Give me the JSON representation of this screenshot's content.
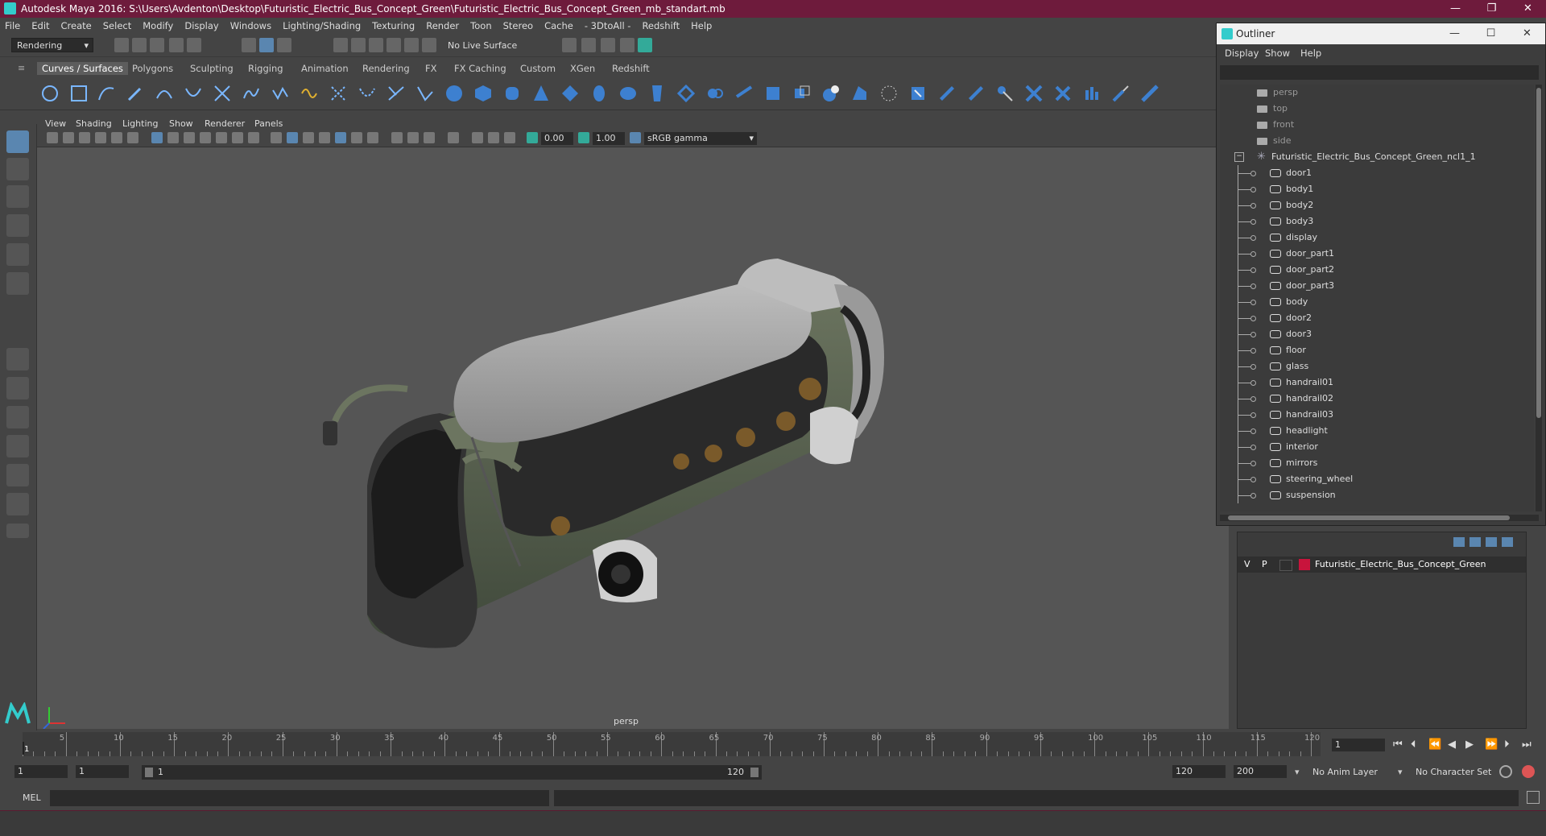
{
  "window": {
    "title": "Autodesk Maya 2016: S:\\Users\\Avdenton\\Desktop\\Futuristic_Electric_Bus_Concept_Green\\Futuristic_Electric_Bus_Concept_Green_mb_standart.mb"
  },
  "menubar": [
    "File",
    "Edit",
    "Create",
    "Select",
    "Modify",
    "Display",
    "Windows",
    "Lighting/Shading",
    "Texturing",
    "Render",
    "Toon",
    "Stereo",
    "Cache",
    "- 3DtoAll -",
    "Redshift",
    "Help"
  ],
  "statusline": {
    "mode": "Rendering",
    "live_surface": "No Live Surface"
  },
  "shelf_tabs": [
    "Curves / Surfaces",
    "Polygons",
    "Sculpting",
    "Rigging",
    "Animation",
    "Rendering",
    "FX",
    "FX Caching",
    "Custom",
    "XGen",
    "Redshift"
  ],
  "panel_menu": [
    "View",
    "Shading",
    "Lighting",
    "Show",
    "Renderer",
    "Panels"
  ],
  "panel_tools": {
    "exposure": "0.00",
    "gamma": "1.00",
    "color_space": "sRGB gamma"
  },
  "viewport": {
    "camera": "persp"
  },
  "outliner": {
    "title": "Outliner",
    "menu": [
      "Display",
      "Show",
      "Help"
    ],
    "cameras": [
      "persp",
      "top",
      "front",
      "side"
    ],
    "group": "Futuristic_Electric_Bus_Concept_Green_ncl1_1",
    "children": [
      "door1",
      "body1",
      "body2",
      "body3",
      "display",
      "door_part1",
      "door_part2",
      "door_part3",
      "body",
      "door2",
      "door3",
      "floor",
      "glass",
      "handrail01",
      "handrail02",
      "handrail03",
      "headlight",
      "interior",
      "mirrors",
      "steering_wheel",
      "suspension"
    ]
  },
  "layers": {
    "row": {
      "v": "V",
      "p": "P",
      "name": "Futuristic_Electric_Bus_Concept_Green",
      "color": "#c8143c"
    }
  },
  "timeline": {
    "ticks": [
      "5",
      "10",
      "15",
      "20",
      "25",
      "30",
      "35",
      "40",
      "45",
      "50",
      "55",
      "60",
      "65",
      "70",
      "75",
      "80",
      "85",
      "90",
      "95",
      "100",
      "105",
      "110",
      "115",
      "120"
    ],
    "current_frame": "1",
    "frame_field": "1"
  },
  "range": {
    "start": "1",
    "start2": "1",
    "slider_start": "1",
    "slider_end": "120",
    "end": "120",
    "end2": "200",
    "anim_layer": "No Anim Layer",
    "char_set": "No Character Set"
  },
  "cmdline": {
    "label": "MEL"
  },
  "colors": {
    "title_bg": "#6e1b3c",
    "accent": "#5a86b0",
    "layer_color": "#c8143c"
  }
}
